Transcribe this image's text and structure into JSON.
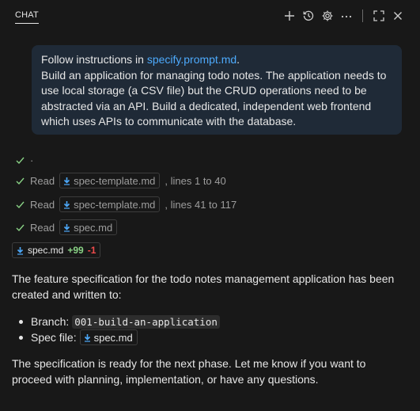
{
  "header": {
    "tab_label": "CHAT",
    "actions": [
      "plus-icon",
      "history-icon",
      "gear-icon",
      "more-icon",
      "maximize-icon",
      "close-icon"
    ]
  },
  "user_message": {
    "line1_prefix": "Follow instructions in ",
    "line1_link": "specify.prompt.md",
    "line1_suffix": ".",
    "body": "Build an application for managing todo notes. The application needs to use local storage (a CSV file) but the CRUD operations need to be abstracted via an API. Build a dedicated, independent web frontend which uses APIs to communicate with the database."
  },
  "steps": [
    {
      "verb": "·",
      "file": "",
      "suffix": ""
    },
    {
      "verb": "Read",
      "file": "spec-template.md",
      "suffix": ", lines 1 to 40"
    },
    {
      "verb": "Read",
      "file": "spec-template.md",
      "suffix": ", lines 41 to 117"
    },
    {
      "verb": "Read",
      "file": "spec.md",
      "suffix": ""
    }
  ],
  "edit": {
    "file": "spec.md",
    "added": "+99",
    "removed": "-1"
  },
  "response": {
    "intro": "The feature specification for the todo notes management application has been created and written to:",
    "branch_label": "Branch:",
    "branch_value": "001-build-an-application",
    "spec_label": "Spec file:",
    "spec_value": "spec.md",
    "outro": "The specification is ready for the next phase. Let me know if you want to proceed with planning, implementation, or have any questions."
  },
  "colors": {
    "accent_link": "#4daafc",
    "check": "#89d185",
    "added": "#89d185",
    "removed": "#f14c4c",
    "user_bubble": "#1f2a37"
  }
}
